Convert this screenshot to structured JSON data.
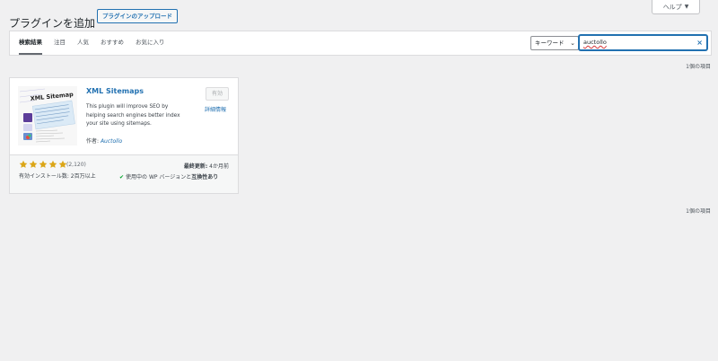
{
  "header": {
    "help_label": "ヘルプ",
    "title": "プラグインを追加",
    "upload_label": "プラグインのアップロード"
  },
  "tabs": [
    {
      "label": "検索結果",
      "active": true
    },
    {
      "label": "注目",
      "active": false
    },
    {
      "label": "人気",
      "active": false
    },
    {
      "label": "おすすめ",
      "active": false
    },
    {
      "label": "お気に入り",
      "active": false
    }
  ],
  "search": {
    "type_selected": "キーワード",
    "value": "auctollo"
  },
  "result_count": "1個の項目",
  "plugin": {
    "name": "XML Sitemaps",
    "description": "This plugin will improve SEO by helping search engines better index your site using sitemaps.",
    "author_label": "作者:",
    "author_name": "Auctollo",
    "activate_label": "有効",
    "details_label": "詳細情報",
    "rating": 5,
    "rating_count": "(2,120)",
    "installs": "有効インストール数: 2百万以上",
    "updated_label": "最終更新:",
    "updated_value": "4か月前",
    "compat_prefix": "使用中の WP バージョンと",
    "compat_strong": "互換性あり",
    "thumb_title": "XML Sitemap"
  },
  "colors": {
    "accent": "#2271b1",
    "star": "#dba617",
    "compat_check": "#00a32a"
  }
}
